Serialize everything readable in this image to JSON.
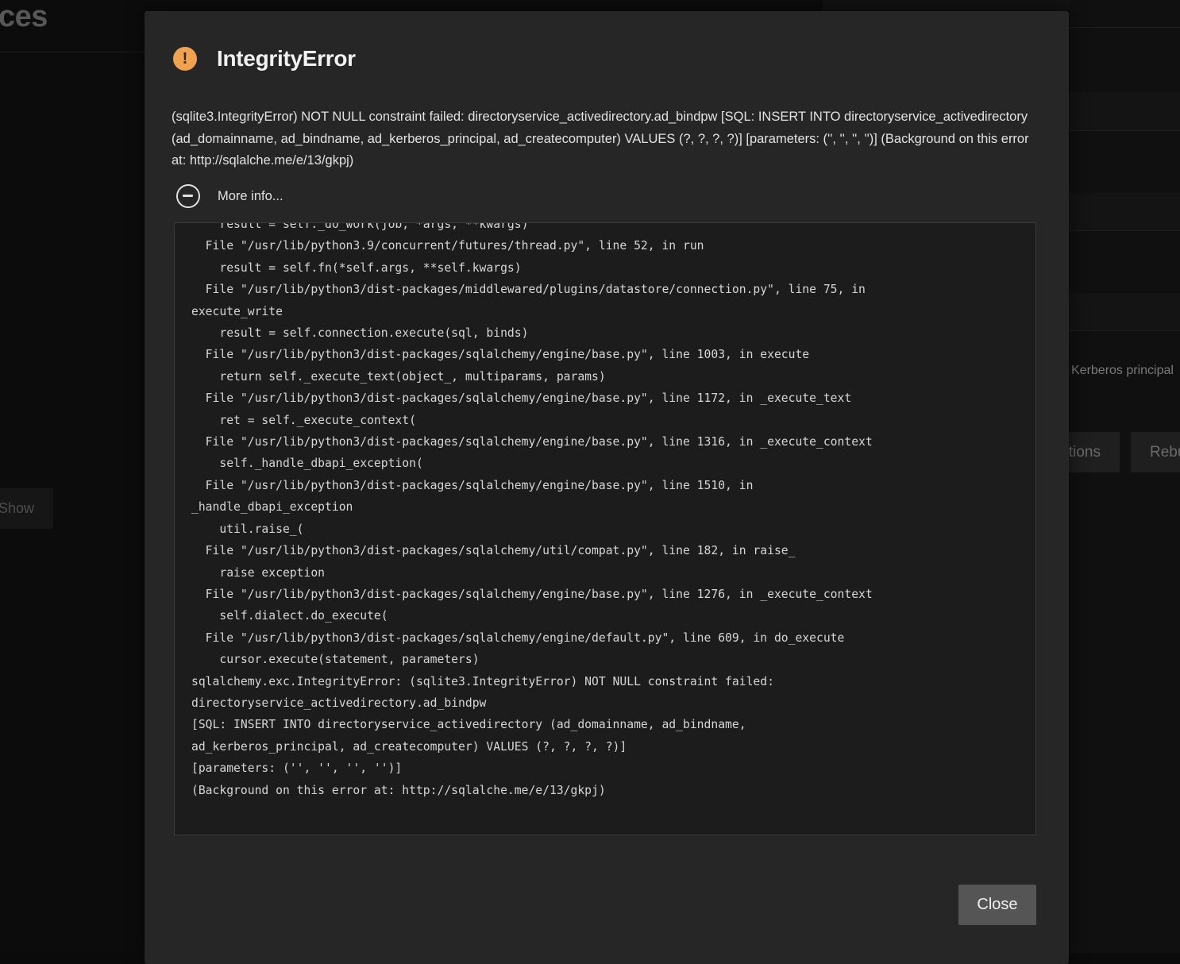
{
  "background": {
    "page_title_fragment": "ces",
    "show_button": "Show",
    "kerberos_label": "Kerberos principal",
    "actions_button_fragment": "tions",
    "rebuild_button_fragment": "Rebu"
  },
  "dialog": {
    "title": "IntegrityError",
    "icon": "warning-icon",
    "message": "(sqlite3.IntegrityError) NOT NULL constraint failed: directoryservice_activedirectory.ad_bindpw [SQL: INSERT INTO directoryservice_activedirectory (ad_domainname, ad_bindname, ad_kerberos_principal, ad_createcomputer) VALUES (?, ?, ?, ?)] [parameters: ('', '', '', '')] (Background on this error at: http://sqlalche.me/e/13/gkpj)",
    "more_info_label": "More info...",
    "traceback": [
      "    result = self._do_work(job, *args, **kwargs)",
      "  File \"/usr/lib/python3.9/concurrent/futures/thread.py\", line 52, in run",
      "    result = self.fn(*self.args, **self.kwargs)",
      "  File \"/usr/lib/python3/dist-packages/middlewared/plugins/datastore/connection.py\", line 75, in",
      "execute_write",
      "    result = self.connection.execute(sql, binds)",
      "  File \"/usr/lib/python3/dist-packages/sqlalchemy/engine/base.py\", line 1003, in execute",
      "    return self._execute_text(object_, multiparams, params)",
      "  File \"/usr/lib/python3/dist-packages/sqlalchemy/engine/base.py\", line 1172, in _execute_text",
      "    ret = self._execute_context(",
      "  File \"/usr/lib/python3/dist-packages/sqlalchemy/engine/base.py\", line 1316, in _execute_context",
      "    self._handle_dbapi_exception(",
      "  File \"/usr/lib/python3/dist-packages/sqlalchemy/engine/base.py\", line 1510, in",
      "_handle_dbapi_exception",
      "    util.raise_(",
      "  File \"/usr/lib/python3/dist-packages/sqlalchemy/util/compat.py\", line 182, in raise_",
      "    raise exception",
      "  File \"/usr/lib/python3/dist-packages/sqlalchemy/engine/base.py\", line 1276, in _execute_context",
      "    self.dialect.do_execute(",
      "  File \"/usr/lib/python3/dist-packages/sqlalchemy/engine/default.py\", line 609, in do_execute",
      "    cursor.execute(statement, parameters)",
      "sqlalchemy.exc.IntegrityError: (sqlite3.IntegrityError) NOT NULL constraint failed:",
      "directoryservice_activedirectory.ad_bindpw",
      "[SQL: INSERT INTO directoryservice_activedirectory (ad_domainname, ad_bindname,",
      "ad_kerberos_principal, ad_createcomputer) VALUES (?, ?, ?, ?)]",
      "[parameters: ('', '', '', '')]",
      "(Background on this error at: http://sqlalche.me/e/13/gkpj)"
    ],
    "close_label": "Close"
  },
  "colors": {
    "modal_bg": "#262626",
    "trace_bg": "#1c1c1c",
    "warning_accent": "#f0a251",
    "close_button_bg": "#555555"
  }
}
